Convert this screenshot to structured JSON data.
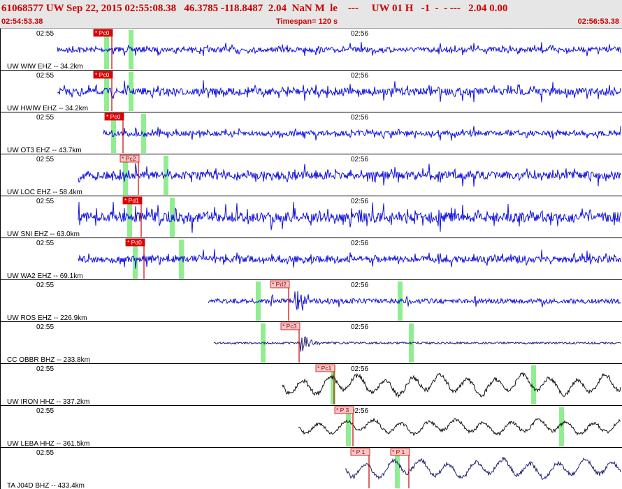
{
  "header": {
    "title": "61068577 UW Sep 22, 2015 02:55:08.38   46.3785 -118.8487  2.04  NaN M  le    ---     UW 01 H   -1  -  - ---   2.04 0.00",
    "start_time": "02:54:53.38",
    "timespan": "Timespan= 120 s",
    "end_time": "02:56:53.38"
  },
  "colors": {
    "trace_blue": "#1010e0",
    "trace_black": "#101010",
    "trace_navy": "#202070",
    "pick_fill_red": "#e00000",
    "pick_fill_pink": "#f8c8c8",
    "pick_line": "#cc0000",
    "window_green": "#90ee90"
  },
  "time_labels": [
    "02:55",
    "02:56"
  ],
  "channels": [
    {
      "label": "UW WIW EHZ -- 34.2km",
      "color": "blue",
      "pick": "* Pc0",
      "pick_style": "red"
    },
    {
      "label": "UW HWIW EHZ -- 34.2km",
      "color": "blue",
      "pick": "* Pc0",
      "pick_style": "red"
    },
    {
      "label": "UW OT3 EHZ -- 43.7km",
      "color": "blue",
      "pick": "* Pc0",
      "pick_style": "red"
    },
    {
      "label": "UW LOC EHZ -- 58.4km",
      "color": "blue",
      "pick": "* Pc2",
      "pick_style": "pink"
    },
    {
      "label": "UW SNI EHZ -- 63.0km",
      "color": "blue",
      "pick": "* Pd1",
      "pick_style": "red"
    },
    {
      "label": "UW WA2 EHZ -- 69.1km",
      "color": "blue",
      "pick": "* Pd0",
      "pick_style": "red"
    },
    {
      "label": "UW ROS EHZ -- 226.9km",
      "color": "blue",
      "pick": "* Pd2",
      "pick_style": "pink"
    },
    {
      "label": "CC OBBR BHZ -- 233.8km",
      "color": "navy",
      "pick": "* Pc3",
      "pick_style": "pink"
    },
    {
      "label": "UW IRON HHZ -- 337.2km",
      "color": "black",
      "pick": "* Pc1",
      "pick_style": "pink"
    },
    {
      "label": "UW LEBA HHZ -- 361.5km",
      "color": "black",
      "pick": "* P 3",
      "pick_style": "pink"
    },
    {
      "label": "TA J04D BHZ -- 433.4km",
      "color": "navy",
      "pick": "* P 1",
      "pick_style": "pink",
      "pick2": "* P 1"
    }
  ]
}
